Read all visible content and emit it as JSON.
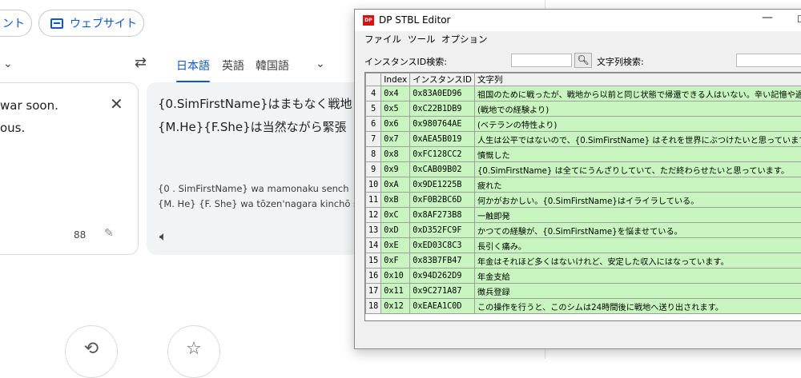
{
  "translate": {
    "chip_left_label": "ント",
    "chip_website_label": "ウェブサイト",
    "swap_glyph": "⇄",
    "target_langs": [
      "日本語",
      "英語",
      "韓国語"
    ],
    "source_lines": [
      "war soon.",
      "ous."
    ],
    "char_count": "88",
    "target_lines": [
      "{0.SimFirstName}はまもなく戦地",
      "{M.He}{F.She}は当然ながら緊張"
    ],
    "romanization_lines": [
      "{0 . SimFirstName} wa mamonaku sench",
      "{M. He} {F. She} wa tōzen'nagara kinchō s"
    ]
  },
  "editor": {
    "title": "DP STBL Editor",
    "menu": [
      "ファイル",
      "ツール",
      "オプション"
    ],
    "instance_search_label": "インスタンスID検索:",
    "instance_search_value": "",
    "string_search_label": "文字列検索:",
    "string_search_value": "",
    "columns": [
      "",
      "Index",
      "インスタンスID",
      "文字列"
    ],
    "rows": [
      {
        "n": "4",
        "index": "0x4",
        "id": "0x83A0ED96",
        "text": "祖国のために戦ったが、戦地から以前と同じ状態で帰還できる人はいない。辛い記憶や過"
      },
      {
        "n": "5",
        "index": "0x5",
        "id": "0xC22B1DB9",
        "text": "(戦地での経験より)"
      },
      {
        "n": "6",
        "index": "0x6",
        "id": "0x980764AE",
        "text": "(ベテランの特性より)"
      },
      {
        "n": "7",
        "index": "0x7",
        "id": "0xAEA5B019",
        "text": "人生は公平ではないので、{0.SimFirstName} はそれを世界にぶつけたいと思っています。"
      },
      {
        "n": "8",
        "index": "0x8",
        "id": "0xFC128CC2",
        "text": "憤慨した"
      },
      {
        "n": "9",
        "index": "0x9",
        "id": "0xCAB09B02",
        "text": "{0.SimFirstName} は全てにうんざりしていて、ただ終わらせたいと思っています。"
      },
      {
        "n": "10",
        "index": "0xA",
        "id": "0x9DE1225B",
        "text": "疲れた"
      },
      {
        "n": "11",
        "index": "0xB",
        "id": "0xF0B2BC6D",
        "text": "何かがおかしい。{0.SimFirstName}はイライラしている。"
      },
      {
        "n": "12",
        "index": "0xC",
        "id": "0x8AF273B8",
        "text": "一触即発"
      },
      {
        "n": "13",
        "index": "0xD",
        "id": "0xD352FC9F",
        "text": "かつての経験が、{0.SimFirstName}を悩ませている。"
      },
      {
        "n": "14",
        "index": "0xE",
        "id": "0xED03C8C3",
        "text": "長引く痛み。"
      },
      {
        "n": "15",
        "index": "0xF",
        "id": "0x83B7FB47",
        "text": "年金はそれほど多くはないけれど、安定した収入にはなっています。"
      },
      {
        "n": "16",
        "index": "0x10",
        "id": "0x94D262D9",
        "text": "年金支給"
      },
      {
        "n": "17",
        "index": "0x11",
        "id": "0x9C271A87",
        "text": "徴兵登録"
      },
      {
        "n": "18",
        "index": "0x12",
        "id": "0xEAEA1C0D",
        "text": "この操作を行うと、このシムは24時間後に戦地へ送り出されます。"
      }
    ]
  }
}
